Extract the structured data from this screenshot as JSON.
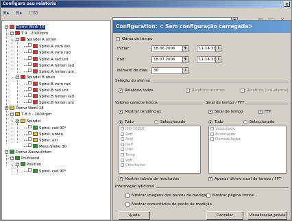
{
  "window": {
    "title": "Configure seu relatório",
    "close": "x"
  },
  "toolbar": {
    "combo_value": "",
    "combo_arrow": "▼"
  },
  "tree": [
    {
      "label": "Demo Werk 16",
      "selected": true
    },
    {
      "label": "T 9 - 2000rpm"
    },
    {
      "label": "Spindel A unten"
    },
    {
      "label": "Spind.A vorn axi"
    },
    {
      "label": "Spind.A vorn rad"
    },
    {
      "label": "Spind.A rad unt"
    },
    {
      "label": "Spind.A hinten rad"
    },
    {
      "label": "Spind.A hinten unt"
    },
    {
      "label": "Spindel B oben"
    },
    {
      "label": "Spind.B vorn rad"
    },
    {
      "label": "Spind.B rad unt"
    },
    {
      "label": "Spind.B hinten rad"
    },
    {
      "label": "Spind.B hinten unt"
    },
    {
      "label": "Demo Werk 18"
    },
    {
      "label": "T 8.3 - 2000rpm"
    },
    {
      "label": "Spindel"
    },
    {
      "label": "Spind. rad 90°"
    },
    {
      "label": "Spind. unten"
    },
    {
      "label": "Spind. axi"
    },
    {
      "label": "Mess-Stelle 30"
    },
    {
      "label": "Demo Auswuchten"
    },
    {
      "label": "Prüfstand"
    },
    {
      "label": "Position"
    },
    {
      "label": "Spind. rad 90°"
    }
  ],
  "config": {
    "header": "Configuration: < Sem configuração carregada>",
    "time_range": "Gama de tempo",
    "start_label": "Iniciar:",
    "start_date": "18.06.2006",
    "start_time": "11:14:33",
    "end_label": "End:",
    "end_date": "18.07.2006",
    "end_time": "11:14:33",
    "days_label": "Número de dias:",
    "days_value": "30",
    "alarm_group": "Seleção do alarme",
    "all_reports": "Relatório todos",
    "alarm_reports": "Relatório alarmes",
    "warn_reports": "Relatório (pré-alarme)",
    "char_group": "Valores característicos",
    "show_trends": "Mostrar tendências",
    "all": "Tudo",
    "selected": "Seleccionado",
    "char_items": [
      "ISO 10816",
      "Aeff",
      "Axel",
      "Deff",
      "Dsel",
      "Temp",
      "Veff",
      "Crestfactor"
    ],
    "show_results": "Mostrar tabela de resultados",
    "signal_group": "Sinal de tempo / FFT",
    "time_signal": "Sinal de tempo",
    "fft": "FFT",
    "signal_items": [
      "Velocidade",
      "Aceleração",
      "Demodulação"
    ],
    "last_only": "Apenas último sinal de tempo / FFT",
    "extra_group": "Informação adicional",
    "show_images": "Mostrar imagens dos pontos de medição",
    "show_front": "Mostrar página frontal",
    "show_comments": "Mostrar comentários do ponto de medição"
  },
  "buttons": {
    "help": "Ajuda",
    "cancel": "Cancelar",
    "preview": "Visualização prévia"
  },
  "colors": {
    "header": "#3a6ea5",
    "folder_red": "#e03030",
    "folder_green": "#20a020",
    "folder_yellow": "#e8c030"
  }
}
